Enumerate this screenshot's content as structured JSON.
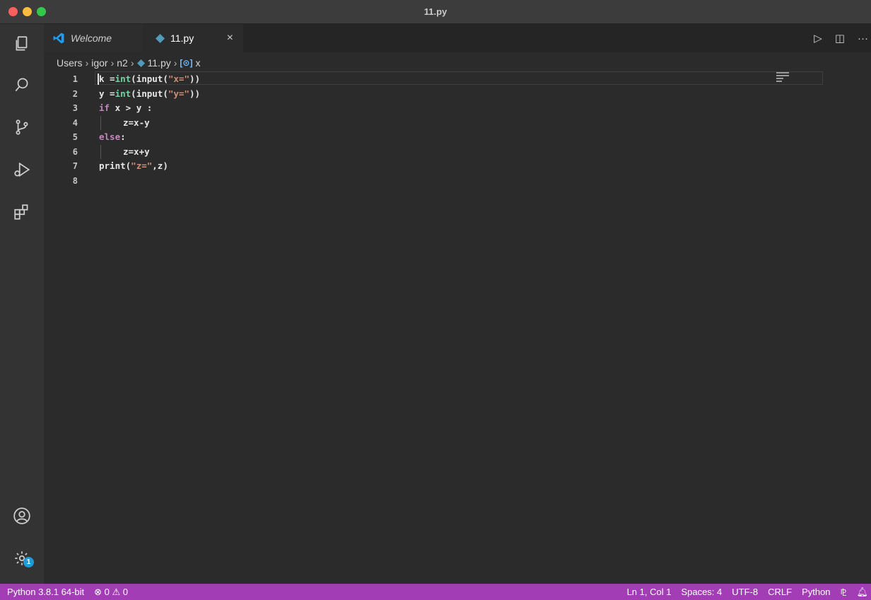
{
  "window": {
    "title": "11.py"
  },
  "tabs": [
    {
      "label": "Welcome",
      "icon": "vscode-logo-icon"
    },
    {
      "label": "11.py",
      "icon": "python-file-icon",
      "close": "×"
    }
  ],
  "tab_actions": {
    "run": "▷",
    "split": "◫",
    "more": "···"
  },
  "breadcrumb": {
    "items": [
      "Users",
      "igor",
      "n2",
      "11.py",
      "x"
    ],
    "separator": "›"
  },
  "editor": {
    "line_numbers": [
      "1",
      "2",
      "3",
      "4",
      "5",
      "6",
      "7",
      "8"
    ],
    "lines": [
      {
        "tokens": [
          [
            "k",
            ""
          ],
          [
            " =",
            ""
          ],
          [
            "int",
            "fn"
          ],
          [
            "(",
            ""
          ],
          [
            "input",
            ""
          ],
          [
            "(",
            ""
          ],
          [
            "\"x=\"",
            "str"
          ],
          [
            "))",
            ""
          ]
        ],
        "indent": false
      },
      {
        "tokens": [
          [
            "y =",
            ""
          ],
          [
            "int",
            "fn"
          ],
          [
            "(",
            ""
          ],
          [
            "input",
            ""
          ],
          [
            "(",
            ""
          ],
          [
            "\"y=\"",
            "str"
          ],
          [
            "))",
            ""
          ]
        ],
        "indent": false
      },
      {
        "tokens": [
          [
            "if",
            "kw"
          ],
          [
            " x > y :",
            ""
          ]
        ],
        "indent": false
      },
      {
        "tokens": [
          [
            "z=x-y",
            ""
          ]
        ],
        "indent": true
      },
      {
        "tokens": [
          [
            "else",
            "kw"
          ],
          [
            ":",
            ""
          ]
        ],
        "indent": false
      },
      {
        "tokens": [
          [
            "z=x+y",
            ""
          ]
        ],
        "indent": true
      },
      {
        "tokens": [
          [
            "print",
            ""
          ],
          [
            "(",
            ""
          ],
          [
            "\"z=\"",
            "str"
          ],
          [
            ",z)",
            ""
          ]
        ],
        "indent": false
      },
      {
        "tokens": [],
        "indent": false
      }
    ]
  },
  "activity_bar": {
    "items": [
      "explorer-icon",
      "search-icon",
      "source-control-icon",
      "run-debug-icon",
      "extensions-icon"
    ],
    "bottom": [
      "account-icon",
      "settings-gear-icon"
    ],
    "settings_badge": "1"
  },
  "status": {
    "interpreter": "Python 3.8.1 64-bit",
    "problems": "⊗ 0 ⚠ 0",
    "position": "Ln 1, Col 1",
    "spaces": "Spaces: 4",
    "encoding": "UTF-8",
    "eol": "CRLF",
    "language": "Python"
  },
  "colors": {
    "statusbar": "#a23db5",
    "editor_bg": "#2b2b2b",
    "keyword": "#c586c0",
    "function": "#6fd4a0",
    "string": "#ce9178"
  }
}
